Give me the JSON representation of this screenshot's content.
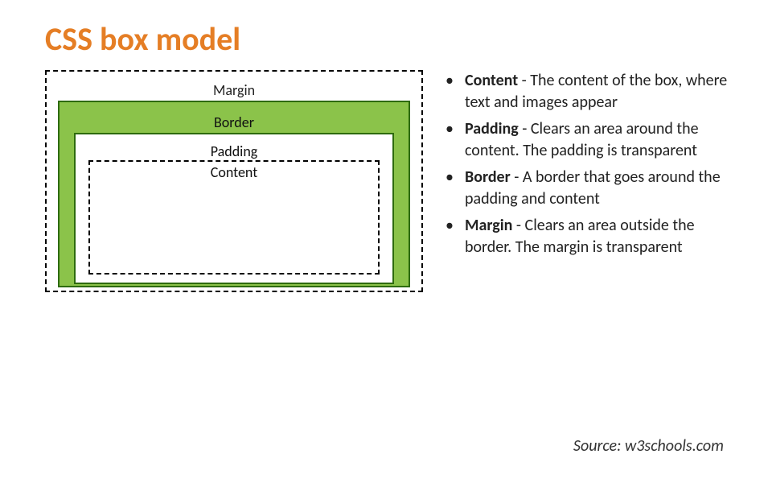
{
  "title": "CSS box model",
  "diagram": {
    "margin": "Margin",
    "border": "Border",
    "padding": "Padding",
    "content": "Content"
  },
  "definitions": [
    {
      "term": "Content",
      "desc": " - The content of the box, where text and images appear"
    },
    {
      "term": "Padding",
      "desc": " - Clears an area around the content. The padding is transparent"
    },
    {
      "term": "Border",
      "desc": " - A border that goes around the padding and content"
    },
    {
      "term": "Margin",
      "desc": " - Clears an area outside the border. The margin is transparent"
    }
  ],
  "source": "Source: w3schools.com"
}
